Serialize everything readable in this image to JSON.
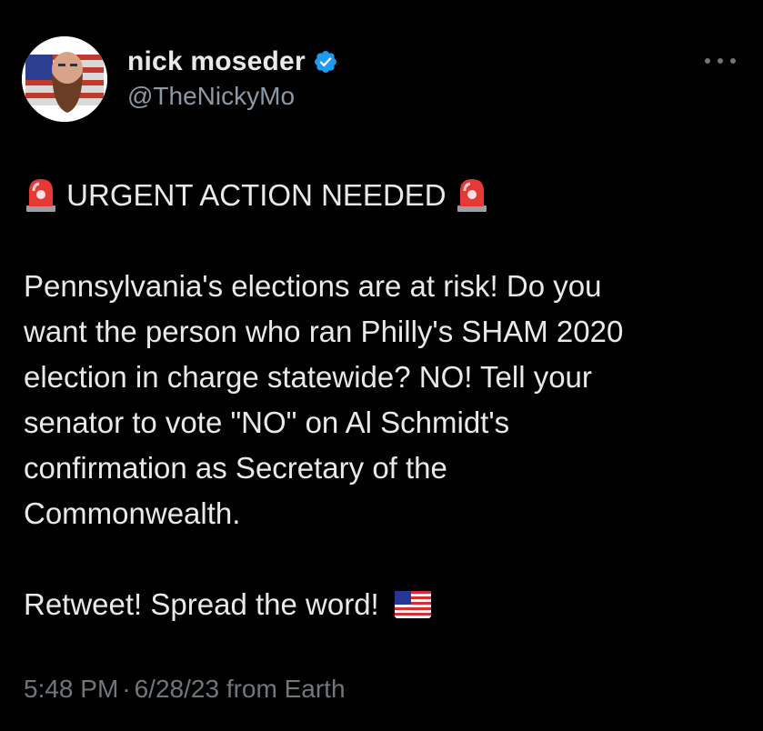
{
  "author": {
    "display_name": "nick moseder",
    "handle": "@TheNickyMo",
    "verified": true
  },
  "tweet": {
    "headline": "URGENT ACTION NEEDED",
    "lines": [
      "Pennsylvania's elections are at risk! Do you",
      "want the person who ran Philly's SHAM 2020",
      "election in charge statewide? NO! Tell your",
      "senator to vote \"NO\" on Al Schmidt's",
      "confirmation as Secretary of the",
      "Commonwealth."
    ],
    "closing": "Retweet! Spread the word!",
    "emojis": {
      "siren": "police-car-light-icon",
      "flag": "us-flag-icon"
    }
  },
  "meta": {
    "time": "5:48 PM",
    "separator": "·",
    "date": "6/28/23",
    "source": "from Earth"
  },
  "colors": {
    "background": "#000000",
    "text": "#e7e9ea",
    "secondary": "#8b98a5",
    "verified": "#1d9bf0"
  }
}
